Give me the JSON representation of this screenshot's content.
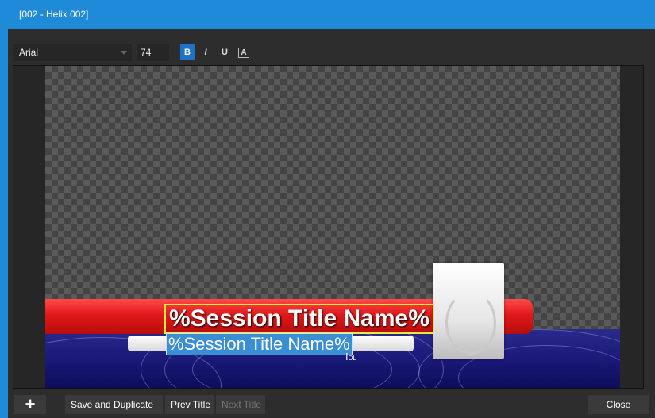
{
  "window": {
    "title": "[002 - Helix 002]"
  },
  "toolbar": {
    "font": "Arial",
    "size": "74",
    "bold_label": "B",
    "italic_label": "I",
    "underline_label": "U",
    "outline_label": "A"
  },
  "canvas": {
    "title_text": "%Session Title Name%",
    "subtitle_text": "%Session Title Name%",
    "cursor_label": "DL",
    "colors": {
      "red_bar": "#e01818",
      "blue_band": "#1a1a7a",
      "selection": "#3a8ed6",
      "text_box_border": "#f4ea3a"
    }
  },
  "bottom": {
    "add_label": "+",
    "save_duplicate": "Save and Duplicate",
    "prev_title": "Prev Title",
    "next_title": "Next Title",
    "close": "Close"
  },
  "icons": [
    "add-icon",
    "caret-down-icon",
    "text-cursor-icon"
  ]
}
